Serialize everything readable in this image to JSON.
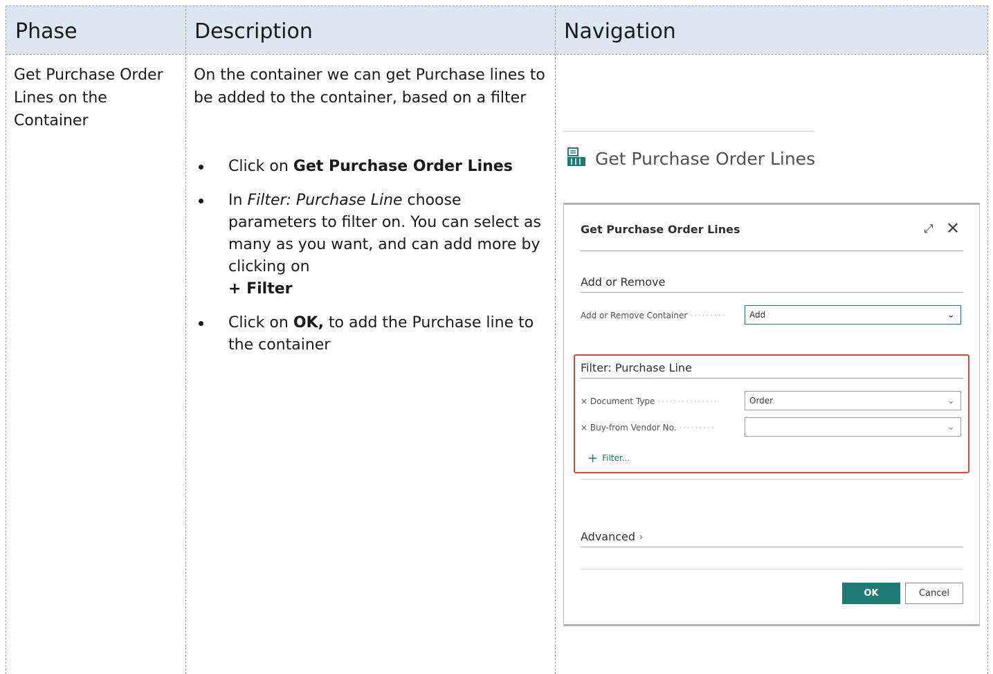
{
  "table": {
    "headers": {
      "phase": "Phase",
      "description": "Description",
      "navigation": "Navigation"
    },
    "row": {
      "phase": "Get Purchase Order Lines on the Container",
      "description_intro": "On the container we can get Purchase lines to be added to the container, based on a filter",
      "steps": [
        {
          "pre": "Click on ",
          "bold": "Get Purchase Order Lines",
          "post": ""
        },
        {
          "pre": "In ",
          "italic": "Filter: Purchase Line",
          "mid": " choose parameters to filter on. You can select as many as you want, and can add more by clicking on ",
          "bold": "+ Filter"
        },
        {
          "pre": "Click on ",
          "bold": "OK,",
          "post": " to add the Purchase line to the container"
        }
      ]
    }
  },
  "navigation": {
    "action": {
      "label": "Get Purchase Order Lines",
      "icon": "container-lines-icon",
      "icon_color": "#1e7a74"
    },
    "dialog": {
      "title": "Get Purchase Order Lines",
      "expand_icon": "expand-icon",
      "close_icon": "close-icon",
      "section_add_remove": "Add or Remove",
      "add_remove_label": "Add or Remove Container",
      "add_remove_value": "Add",
      "section_filter": "Filter: Purchase Line",
      "filters": [
        {
          "label": "Document Type",
          "value": "Order"
        },
        {
          "label": "Buy-from Vendor No.",
          "value": ""
        }
      ],
      "filter_link": "Filter...",
      "section_advanced": "Advanced",
      "ok_label": "OK",
      "cancel_label": "Cancel",
      "accent_color": "#1e7a74",
      "highlight_color": "#d9483b"
    }
  }
}
